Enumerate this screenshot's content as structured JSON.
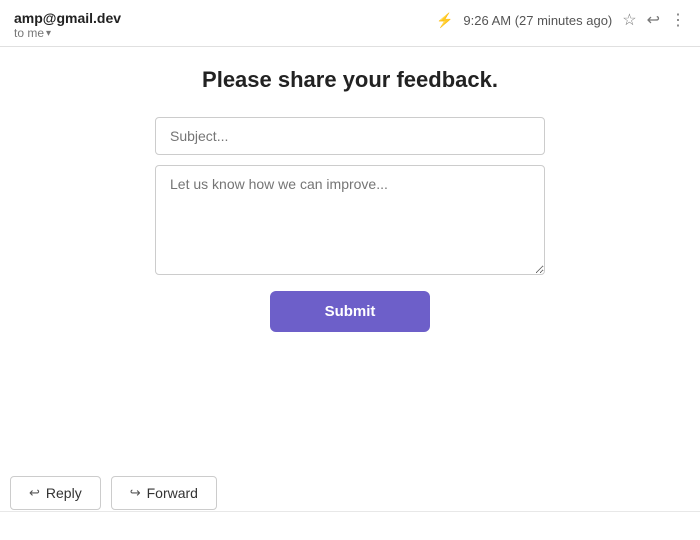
{
  "header": {
    "sender": "amp@gmail.dev",
    "to_label": "to me",
    "chevron": "▾",
    "timestamp": "9:26 AM (27 minutes ago)",
    "lightning_icon": "⚡",
    "star_icon": "☆",
    "reply_icon": "↩",
    "more_icon": "⋮"
  },
  "email": {
    "title": "Please share your feedback.",
    "subject_placeholder": "Subject...",
    "message_placeholder": "Let us know how we can improve...",
    "submit_label": "Submit"
  },
  "actions": {
    "reply_label": "Reply",
    "forward_label": "Forward",
    "reply_icon": "↩",
    "forward_icon": "↪"
  }
}
